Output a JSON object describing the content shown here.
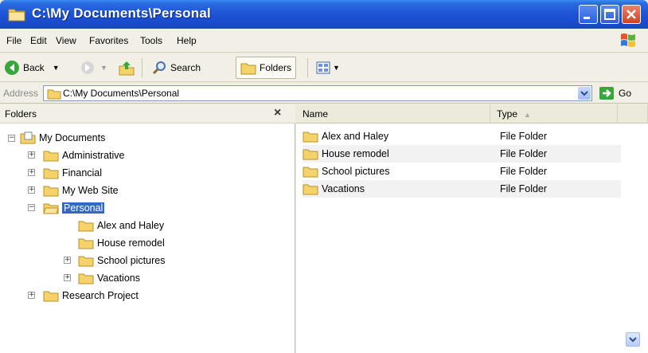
{
  "window": {
    "title": "C:\\My Documents\\Personal"
  },
  "menu": [
    "File",
    "Edit",
    "View",
    "Favorites",
    "Tools",
    "Help"
  ],
  "toolbar": {
    "back_label": "Back",
    "search_label": "Search",
    "folders_label": "Folders"
  },
  "address": {
    "label": "Address",
    "value": "C:\\My Documents\\Personal",
    "go_label": "Go"
  },
  "folders_pane": {
    "title": "Folders",
    "close_label": "×",
    "tree": [
      {
        "label": "My Documents",
        "level": 0,
        "expander": "−",
        "icon": "my-documents-icon"
      },
      {
        "label": "Administrative",
        "level": 1,
        "expander": "+",
        "icon": "folder-icon"
      },
      {
        "label": "Financial",
        "level": 1,
        "expander": "+",
        "icon": "folder-icon"
      },
      {
        "label": "My Web Site",
        "level": 1,
        "expander": "+",
        "icon": "folder-icon"
      },
      {
        "label": "Personal",
        "level": 1,
        "expander": "−",
        "icon": "open-folder-icon",
        "selected": true
      },
      {
        "label": "Alex and Haley",
        "level": 2,
        "expander": "",
        "icon": "folder-icon"
      },
      {
        "label": "House remodel",
        "level": 2,
        "expander": "",
        "icon": "folder-icon"
      },
      {
        "label": "School pictures",
        "level": 2,
        "expander": "+",
        "icon": "folder-icon"
      },
      {
        "label": "Vacations",
        "level": 2,
        "expander": "+",
        "icon": "folder-icon"
      },
      {
        "label": "Research Project",
        "level": 1,
        "expander": "+",
        "icon": "folder-icon"
      }
    ]
  },
  "content_pane": {
    "columns": [
      "Name",
      "Type"
    ],
    "sort_indicator": "▲",
    "rows": [
      {
        "name": "Alex and Haley",
        "type": "File Folder"
      },
      {
        "name": "House remodel",
        "type": "File Folder"
      },
      {
        "name": "School pictures",
        "type": "File Folder"
      },
      {
        "name": "Vacations",
        "type": "File Folder"
      }
    ]
  },
  "colors": {
    "titlebar": "#1f55d6",
    "selection": "#316ac5",
    "folder": "#f5d36a",
    "chrome": "#ece9d8"
  }
}
